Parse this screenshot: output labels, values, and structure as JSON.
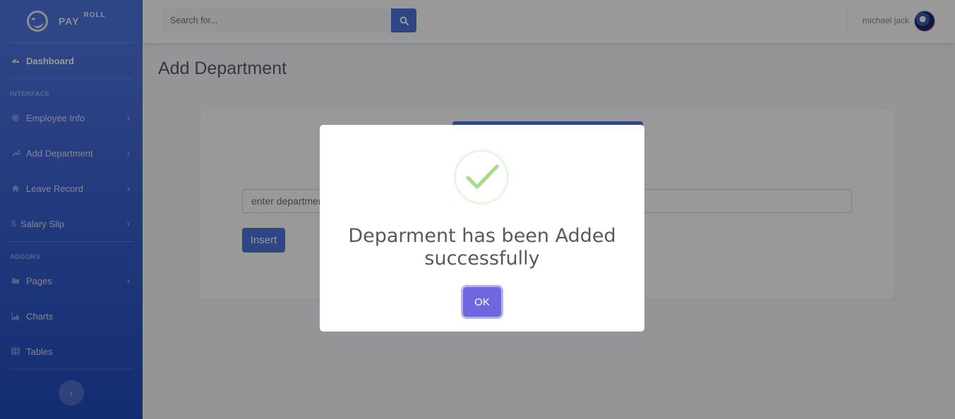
{
  "brand": {
    "name": "PAY",
    "superscript": "ROLL"
  },
  "sidebar": {
    "dashboard": {
      "label": "Dashboard",
      "icon": "tachometer-icon"
    },
    "heading_interface": "INTERFACE",
    "items": [
      {
        "label": "Employee Info",
        "icon": "cog-icon"
      },
      {
        "label": "Add Department",
        "icon": "wrench-icon"
      },
      {
        "label": "Leave Record",
        "icon": "home-icon"
      },
      {
        "label": "Salary Slip",
        "icon": "dollar-icon"
      }
    ],
    "heading_addons": "ADDONS",
    "addons": [
      {
        "label": "Pages",
        "icon": "folder-icon"
      },
      {
        "label": "Charts",
        "icon": "chart-area-icon"
      },
      {
        "label": "Tables",
        "icon": "table-icon"
      }
    ]
  },
  "topbar": {
    "search_placeholder": "Search for...",
    "user_name": "michael jack"
  },
  "main": {
    "page_title": "Add Department",
    "dept_placeholder": "enter department name",
    "insert_label": "Insert"
  },
  "modal": {
    "message": "Deparment has been Added successfully",
    "ok_label": "OK"
  },
  "colors": {
    "primary": "#4e73df",
    "success_check": "#a5dc86",
    "confirm": "#7066e0"
  }
}
